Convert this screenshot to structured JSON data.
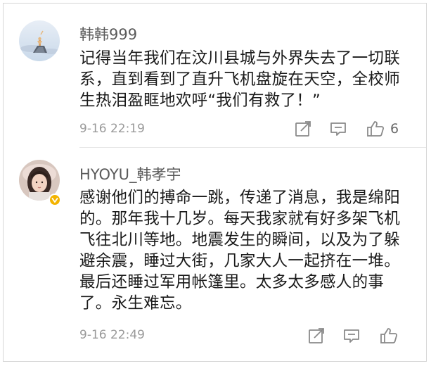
{
  "comments": [
    {
      "username": "韩韩999",
      "text": "记得当年我们在汶川县城与外界失去了一切联系，直到看到了直升飞机盘旋在天空，全校师生热泪盈眶地欢呼“我们有救了！”",
      "timestamp": "9-16 22:19",
      "likes": "6",
      "avatar_icon": "avatar-illustration-icon",
      "verified": false
    },
    {
      "username": "HYOYU_韩孝宇",
      "text": "感谢他们的搏命一跳，传递了消息，我是绵阳的。那年我十几岁。每天我家就有好多架飞机飞往北川等地。地震发生的瞬间，以及为了躲避余震，睡过大街，几家大人一起挤在一堆。最后还睡过军用帐篷里。太多太多感人的事了。永生难忘。",
      "timestamp": "9-16 22:49",
      "likes": "",
      "avatar_icon": "avatar-photo-icon",
      "verified": true
    }
  ],
  "icons": {
    "share": "share-icon",
    "reply": "reply-icon",
    "like": "thumbs-up-icon",
    "verified": "verified-badge-icon"
  },
  "colors": {
    "verified_badge": "#f3b300",
    "meta_text": "#9a9a9a",
    "username_text": "#5a5a5a"
  }
}
